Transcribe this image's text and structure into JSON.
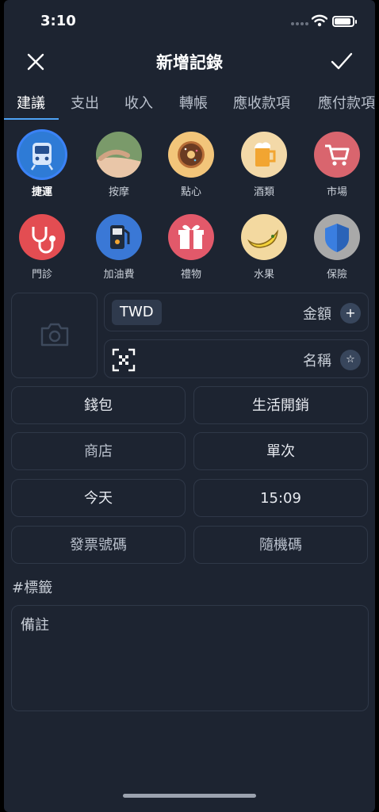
{
  "status_bar": {
    "time": "3:10"
  },
  "nav": {
    "title": "新增記錄"
  },
  "tabs": [
    "建議",
    "支出",
    "收入",
    "轉帳",
    "應收款項",
    "應付款項"
  ],
  "categories": [
    {
      "label": "捷運",
      "icon": "metro-train-icon",
      "bg": "#2e7bd6",
      "selected": true
    },
    {
      "label": "按摩",
      "icon": "massage-icon",
      "bg": "#7a9a6a"
    },
    {
      "label": "點心",
      "icon": "donut-icon",
      "bg": "#f2c57a"
    },
    {
      "label": "酒類",
      "icon": "beer-icon",
      "bg": "#f3d9a8"
    },
    {
      "label": "市場",
      "icon": "shopping-cart-icon",
      "bg": "#d9656e"
    },
    {
      "label": "門診",
      "icon": "stethoscope-icon",
      "bg": "#e34d52"
    },
    {
      "label": "加油費",
      "icon": "fuel-pump-icon",
      "bg": "#3a78d6"
    },
    {
      "label": "禮物",
      "icon": "gift-icon",
      "bg": "#e2596a"
    },
    {
      "label": "水果",
      "icon": "banana-icon",
      "bg": "#f3d9a0"
    },
    {
      "label": "保險",
      "icon": "shield-icon",
      "bg": "#a9a9a9"
    }
  ],
  "amount": {
    "currency": "TWD",
    "label": "金額"
  },
  "name": {
    "label": "名稱"
  },
  "fields": {
    "wallet": "錢包",
    "category": "生活開銷",
    "store": "商店",
    "frequency": "單次",
    "date": "今天",
    "time": "15:09",
    "invoice": "發票號碼",
    "random_code": "隨機碼"
  },
  "tags_placeholder": "#標籤",
  "note_placeholder": "備註"
}
